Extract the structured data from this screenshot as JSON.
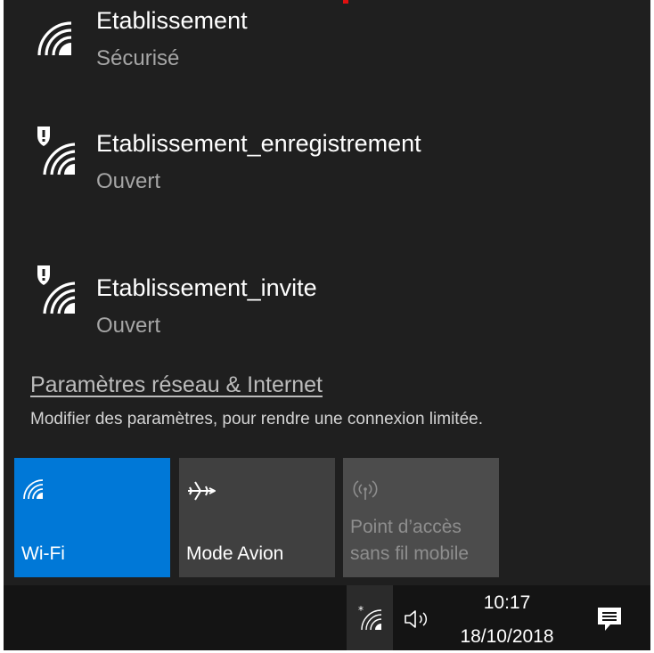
{
  "networks": [
    {
      "name": "Etablissement",
      "status": "Sécurisé",
      "icon": "wifi-signal-icon"
    },
    {
      "name": "Etablissement_enregistrement",
      "status": "Ouvert",
      "icon": "wifi-open-warning-icon"
    },
    {
      "name": "Etablissement_invite",
      "status": "Ouvert",
      "icon": "wifi-open-warning-icon"
    }
  ],
  "settings": {
    "link": "Paramètres réseau & Internet",
    "description": "Modifier des paramètres, pour rendre une connexion limitée."
  },
  "tiles": {
    "wifi": {
      "label": "Wi-Fi",
      "icon": "wifi-icon",
      "color": "#0078d7",
      "active": true
    },
    "avion": {
      "label": "Mode Avion",
      "icon": "airplane-icon",
      "active": false
    },
    "hotspot": {
      "label_line1": "Point d’accès",
      "label_line2": "sans fil mobile",
      "icon": "hotspot-icon",
      "active": false
    }
  },
  "taskbar": {
    "time": "10:17",
    "date": "18/10/2018",
    "icons": [
      "network-tray-icon",
      "volume-icon",
      "action-center-icon"
    ]
  }
}
